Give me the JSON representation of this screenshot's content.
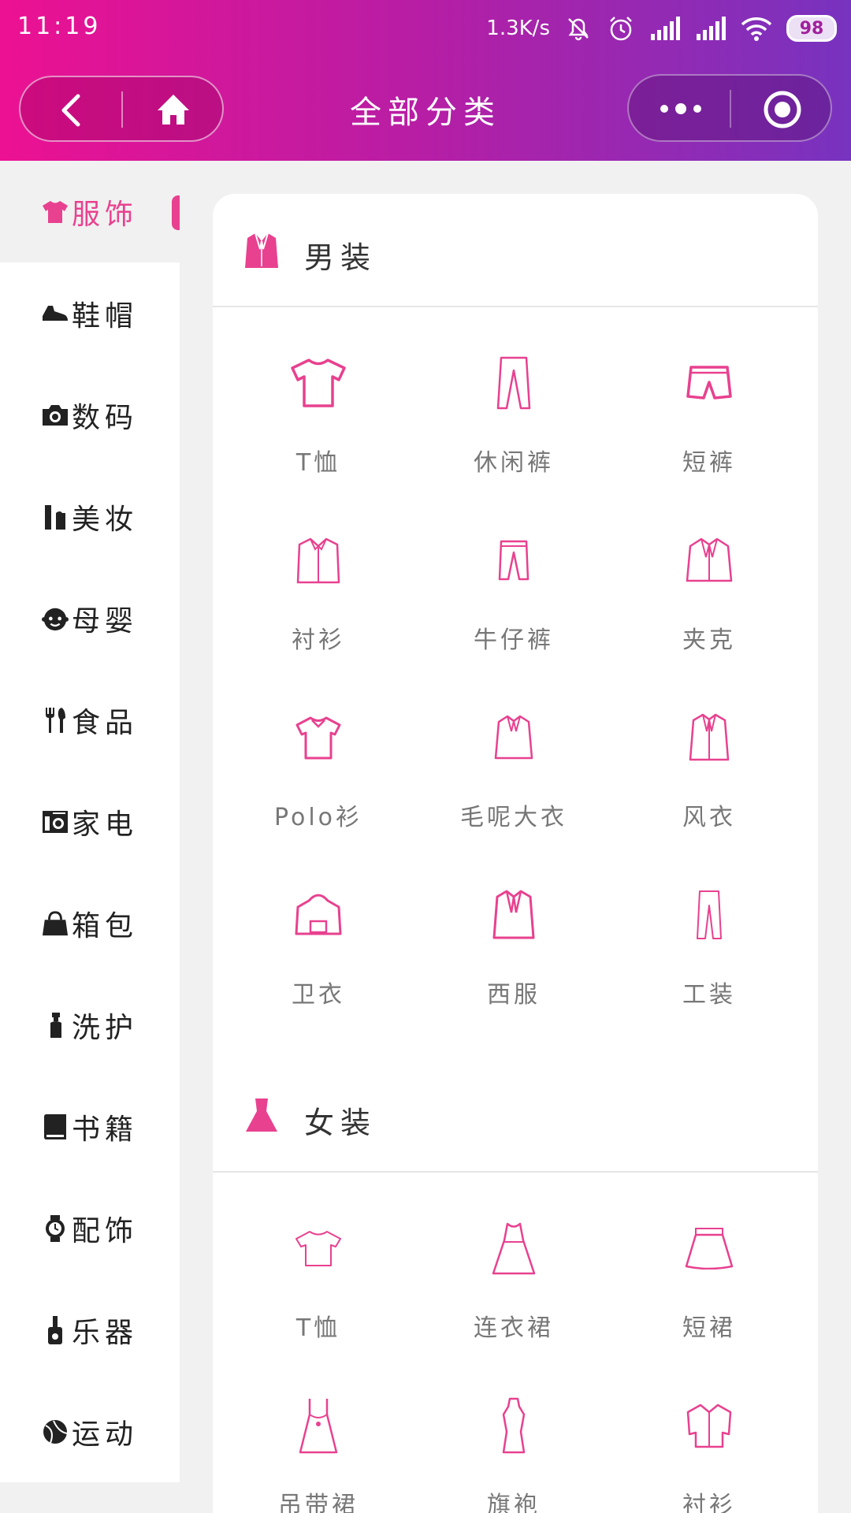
{
  "status_bar": {
    "time": "11:19",
    "speed": "1.3K/s",
    "battery": "98"
  },
  "header": {
    "title": "全部分类"
  },
  "sidebar": {
    "items": [
      {
        "label": "服饰",
        "icon": "shirt-icon"
      },
      {
        "label": "鞋帽",
        "icon": "shoe-icon"
      },
      {
        "label": "数码",
        "icon": "camera-icon"
      },
      {
        "label": "美妆",
        "icon": "lipstick-icon"
      },
      {
        "label": "母婴",
        "icon": "baby-icon"
      },
      {
        "label": "食品",
        "icon": "cutlery-icon"
      },
      {
        "label": "家电",
        "icon": "appliance-icon"
      },
      {
        "label": "箱包",
        "icon": "bag-icon"
      },
      {
        "label": "洗护",
        "icon": "spray-bottle-icon"
      },
      {
        "label": "书籍",
        "icon": "book-icon"
      },
      {
        "label": "配饰",
        "icon": "watch-icon"
      },
      {
        "label": "乐器",
        "icon": "guitar-icon"
      },
      {
        "label": "运动",
        "icon": "ball-icon"
      }
    ]
  },
  "sections": [
    {
      "title": "男装",
      "icon": "suit-icon",
      "items": [
        "T恤",
        "休闲裤",
        "短裤",
        "衬衫",
        "牛仔裤",
        "夹克",
        "Polo衫",
        "毛呢大衣",
        "风衣",
        "卫衣",
        "西服",
        "工装"
      ]
    },
    {
      "title": "女装",
      "icon": "dress-icon",
      "items": [
        "T恤",
        "连衣裙",
        "短裙",
        "吊带裙",
        "旗袍",
        "衬衫"
      ]
    }
  ],
  "colors": {
    "accent": "#e8418f",
    "header_start": "#ec1192",
    "header_end": "#7733bf"
  }
}
